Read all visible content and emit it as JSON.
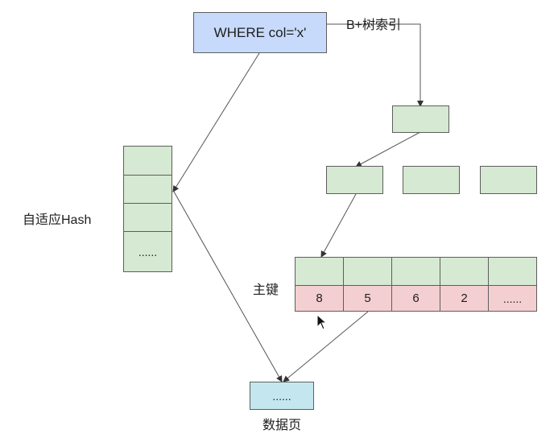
{
  "query": {
    "text": "WHERE col='x'"
  },
  "labels": {
    "btree_index": "B+树索引",
    "adaptive_hash": "自适应Hash",
    "primary_key": "主键",
    "data_page": "数据页"
  },
  "hash_table": {
    "cells": [
      "",
      "",
      "",
      "......"
    ]
  },
  "primary_key_row": {
    "cells": [
      "8",
      "5",
      "6",
      "2",
      "......"
    ]
  },
  "data_page": {
    "text": "......"
  },
  "colors": {
    "node_green": "#d6e9d2",
    "key_pink": "#f4cfd1",
    "query_blue": "#c7dafb",
    "page_cyan": "#c4e7ef"
  }
}
